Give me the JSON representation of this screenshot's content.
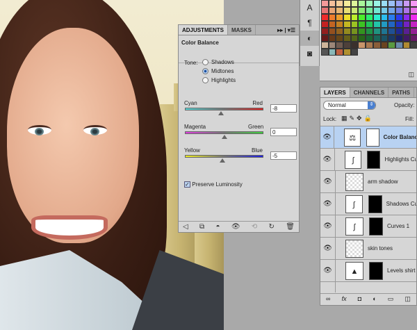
{
  "adjustments": {
    "tabs": [
      "ADJUSTMENTS",
      "MASKS"
    ],
    "title": "Color Balance",
    "tone_label": "Tone:",
    "tones": [
      {
        "label": "Shadows",
        "selected": false
      },
      {
        "label": "Midtones",
        "selected": true
      },
      {
        "label": "Highlights",
        "selected": false
      }
    ],
    "sliders": [
      {
        "left": "Cyan",
        "right": "Red",
        "value": "-8",
        "colors": [
          "#55d8d8",
          "#e02020"
        ]
      },
      {
        "left": "Magenta",
        "right": "Green",
        "value": "0",
        "colors": [
          "#e040e0",
          "#40d040"
        ]
      },
      {
        "left": "Yellow",
        "right": "Blue",
        "value": "-5",
        "colors": [
          "#f0f020",
          "#2020e0"
        ]
      }
    ],
    "preserve_luminosity": {
      "label": "Preserve Luminosity",
      "checked": true
    }
  },
  "layers": {
    "tabs": [
      "LAYERS",
      "CHANNELS",
      "PATHS"
    ],
    "blend_mode": "Normal",
    "opacity_label": "Opacity:",
    "lock_label": "Lock:",
    "fill_label": "Fill:",
    "items": [
      {
        "name": "Color Balanc",
        "selected": true,
        "mask": "white",
        "icon": "balance-icon"
      },
      {
        "name": "Highlights Cu",
        "mask": "black",
        "icon": "curves-icon"
      },
      {
        "name": "arm shadow",
        "mask": null,
        "icon": "transparent-icon"
      },
      {
        "name": "Shadows Cu",
        "mask": "black",
        "icon": "curves-icon"
      },
      {
        "name": "Curves 1",
        "mask": "black",
        "icon": "curves-icon"
      },
      {
        "name": "skin tones",
        "mask": null,
        "icon": "transparent-icon"
      },
      {
        "name": "Levels shirt",
        "mask": "black",
        "icon": "levels-icon"
      }
    ]
  },
  "swatch_hues": [
    0,
    25,
    35,
    55,
    75,
    110,
    140,
    170,
    195,
    215,
    235,
    270,
    300
  ]
}
